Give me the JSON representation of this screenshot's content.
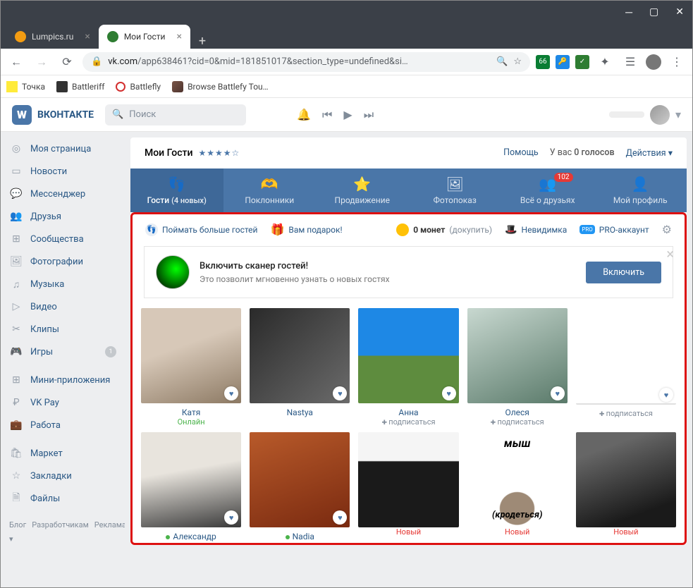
{
  "browser": {
    "tabs": [
      {
        "title": "Lumpics.ru",
        "favicon": "fav-orange"
      },
      {
        "title": "Мои Гости",
        "favicon": "fav-green",
        "active": true
      }
    ],
    "url_host": "vk.com",
    "url_path": "/app638461?cid=0&mid=181851017&section_type=undefined&si…",
    "bookmarks": [
      {
        "label": "Точка",
        "icon": "bm-yellow"
      },
      {
        "label": "Battleriff",
        "icon": "bm-shield"
      },
      {
        "label": "Battlefly",
        "icon": "bm-red"
      },
      {
        "label": "Browse Battlefy Tou…",
        "icon": "bm-img"
      }
    ],
    "ext_badge": "66"
  },
  "vk": {
    "brand": "ВКОНТАКТЕ",
    "search_placeholder": "Поиск",
    "sidebar": [
      {
        "icon": "◎",
        "label": "Моя страница"
      },
      {
        "icon": "▭",
        "label": "Новости"
      },
      {
        "icon": "💬",
        "label": "Мессенджер"
      },
      {
        "icon": "👥",
        "label": "Друзья"
      },
      {
        "icon": "⊞",
        "label": "Сообщества"
      },
      {
        "icon": "🖼",
        "label": "Фотографии"
      },
      {
        "icon": "♫",
        "label": "Музыка"
      },
      {
        "icon": "▷",
        "label": "Видео"
      },
      {
        "icon": "✂",
        "label": "Клипы"
      },
      {
        "icon": "🎮",
        "label": "Игры",
        "badge": "1"
      },
      {
        "sep": true
      },
      {
        "icon": "⊞",
        "label": "Мини-приложения"
      },
      {
        "icon": "₽",
        "label": "VK Pay"
      },
      {
        "icon": "💼",
        "label": "Работа"
      },
      {
        "sep": true
      },
      {
        "icon": "🛍",
        "label": "Маркет"
      },
      {
        "icon": "☆",
        "label": "Закладки"
      },
      {
        "icon": "🗎",
        "label": "Файлы"
      }
    ],
    "footer": [
      "Блог",
      "Разработчикам",
      "Реклама",
      "Ещё ▾"
    ]
  },
  "app": {
    "title": "Мои Гости",
    "stars": "★★★★☆",
    "help": "Помощь",
    "votes_prefix": "У вас ",
    "votes_count": "0 голосов",
    "actions": "Действия ▾",
    "tabs": [
      {
        "icon": "👣",
        "label": "Гости",
        "sub": "(4 новых)",
        "active": true
      },
      {
        "icon": "🫶",
        "label": "Поклонники"
      },
      {
        "icon": "⭐",
        "label": "Продвижение"
      },
      {
        "icon": "🖼",
        "label": "Фотопоказ"
      },
      {
        "icon": "👥",
        "label": "Всё о друзьях",
        "badge": "102"
      },
      {
        "icon": "👤",
        "label": "Мой профиль"
      }
    ],
    "toolbar": {
      "catch": "Поймать больше гостей",
      "gift": "Вам подарок!",
      "coins_count": "0 монет",
      "coins_buy": "(докупить)",
      "invisible": "Невидимка",
      "pro": "PRO-аккаунт"
    },
    "promo": {
      "title": "Включить сканер гостей!",
      "text": "Это позволит мгновенно узнать о новых гостях",
      "button": "Включить"
    },
    "guests": [
      {
        "pic": "p1",
        "name": "Катя",
        "status": "Онлайн",
        "status_class": "st-online",
        "heart": true
      },
      {
        "pic": "p2",
        "name": "Nastya",
        "heart": true
      },
      {
        "pic": "p3",
        "name": "Анна",
        "sub": "подписаться",
        "heart": true
      },
      {
        "pic": "p4",
        "name": "Олеся",
        "sub": "подписаться",
        "heart": true
      },
      {
        "pic": "p5",
        "name": "",
        "sub": "подписаться",
        "heart": true
      },
      {
        "pic": "p6",
        "name": "Александр",
        "online_dot": true,
        "heart": true
      },
      {
        "pic": "p7",
        "name": "Nadia",
        "online_dot": true,
        "heart": true
      },
      {
        "pic": "p8",
        "status": "Новый",
        "status_class": "st-new"
      },
      {
        "pic": "p9",
        "status": "Новый",
        "status_class": "st-new",
        "mouse_top": "мыш",
        "mouse_bot": "(кродеться)"
      },
      {
        "pic": "p10",
        "status": "Новый",
        "status_class": "st-new"
      }
    ]
  }
}
